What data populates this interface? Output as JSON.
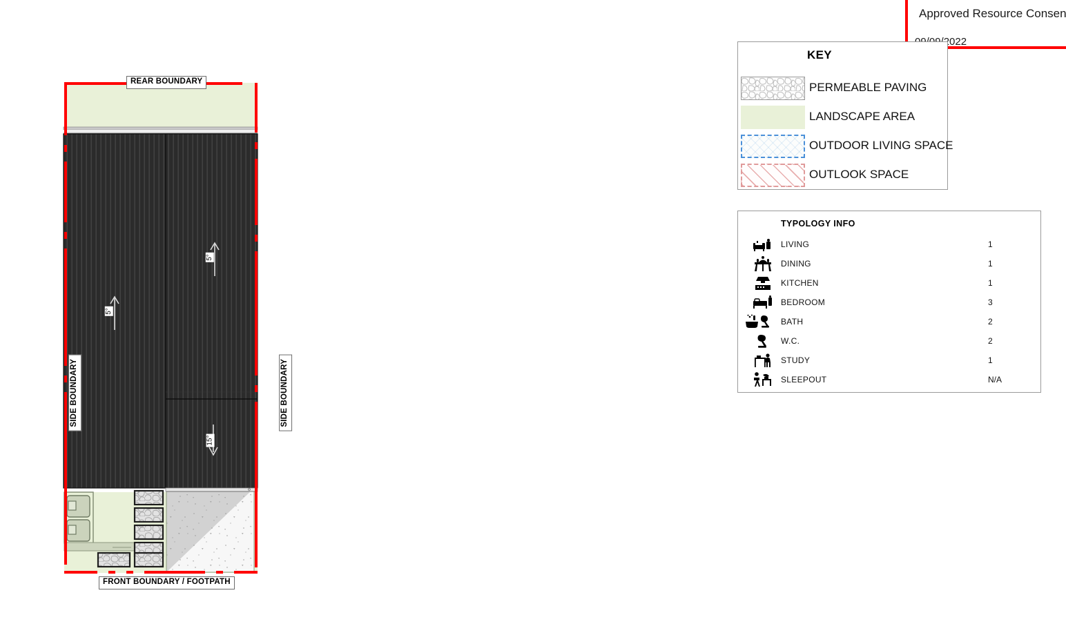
{
  "stamp": {
    "title": "Approved Resource Consent",
    "date": "09/09/2022",
    "border_color": "#ff0000"
  },
  "key": {
    "heading": "KEY",
    "items": [
      {
        "label": "PERMEABLE PAVING",
        "swatch": "permeable-paving-swatch",
        "color": "#fdfdfd"
      },
      {
        "label": "LANDSCAPE AREA",
        "swatch": "landscape-area-swatch",
        "color": "#e9f1d8"
      },
      {
        "label": "OUTDOOR LIVING SPACE",
        "swatch": "outdoor-living-swatch",
        "color": "#4a90d9"
      },
      {
        "label": "OUTLOOK SPACE",
        "swatch": "outlook-space-swatch",
        "color": "#e09a9a"
      }
    ]
  },
  "typology": {
    "heading": "TYPOLOGY INFO",
    "rows": [
      {
        "icon": "living-sofa-icon",
        "label": "LIVING",
        "count": "1"
      },
      {
        "icon": "dining-table-icon",
        "label": "DINING",
        "count": "1"
      },
      {
        "icon": "kitchen-icon",
        "label": "KITCHEN",
        "count": "1"
      },
      {
        "icon": "bed-icon",
        "label": "BEDROOM",
        "count": "3"
      },
      {
        "icon": "bath-toilet-icon",
        "label": "BATH",
        "count": "2"
      },
      {
        "icon": "toilet-icon",
        "label": "W.C.",
        "count": "2"
      },
      {
        "icon": "study-desk-icon",
        "label": "STUDY",
        "count": "1"
      },
      {
        "icon": "sleepout-icon",
        "label": "SLEEPOUT",
        "count": "N/A"
      }
    ]
  },
  "site_plan": {
    "boundaries": {
      "rear": "REAR BOUNDARY",
      "front": "FRONT BOUNDARY / FOOTPATH",
      "side_left": "SIDE BOUNDARY",
      "side_right": "SIDE BOUNDARY"
    },
    "roof_pitches": {
      "left": "5°",
      "middle": "5°",
      "lower": "15°"
    },
    "colors": {
      "boundary_line": "#ff0000",
      "roof_dark": "#2b2b2b",
      "roof_rib": "#4a4a4a",
      "landscape": "#e9f1d8",
      "driveway_light": "#f4f4f4",
      "driveway_shade": "#d2d2d2",
      "fascia": "#d8d8d8"
    }
  }
}
